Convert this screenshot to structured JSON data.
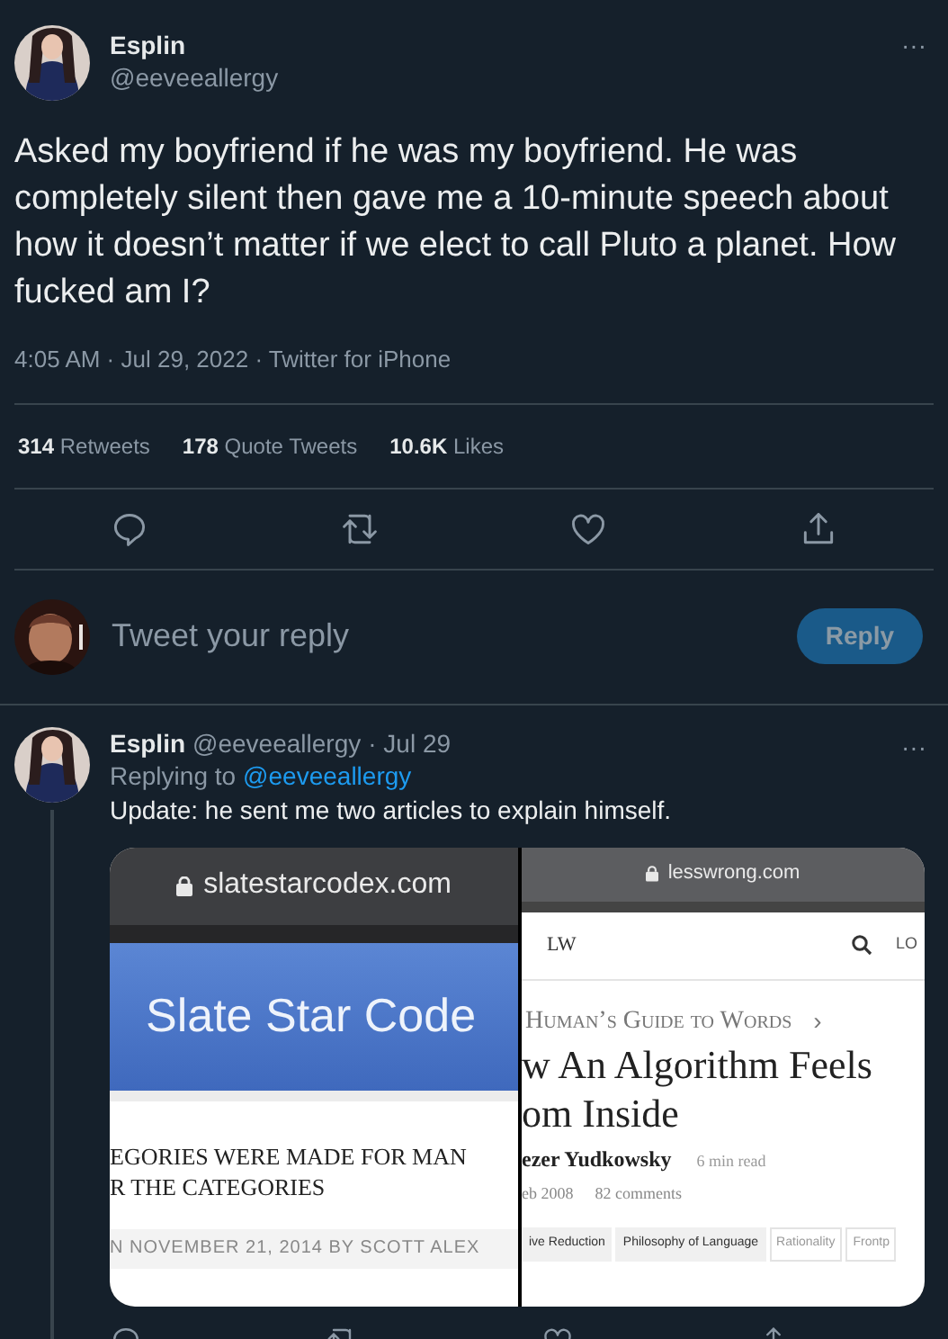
{
  "tweet": {
    "name": "Esplin",
    "handle": "@eeveeallergy",
    "text": "Asked my boyfriend if he was my boyfriend. He was completely silent then gave me a 10-minute speech about how it doesn’t matter if we elect to call Pluto a planet. How fucked am I?",
    "meta": "4:05 AM · Jul 29, 2022 · Twitter for iPhone",
    "more": "···",
    "stats": [
      {
        "count": "314",
        "label": "Retweets"
      },
      {
        "count": "178",
        "label": "Quote Tweets"
      },
      {
        "count": "10.6K",
        "label": "Likes"
      }
    ],
    "actions": [
      {
        "kind": "reply"
      },
      {
        "kind": "retweet"
      },
      {
        "kind": "like"
      },
      {
        "kind": "share"
      }
    ]
  },
  "reply_box": {
    "placeholder": "Tweet your reply",
    "button": "Reply",
    "disabled": true
  },
  "reply": {
    "name": "Esplin",
    "handle": "@eeveeallergy",
    "date": "· Jul 29",
    "more": "···",
    "replying_label": "Replying to",
    "replying_to": "@eeveeallergy",
    "text": "Update: he sent me two articles to explain himself.",
    "attachment": {
      "left": {
        "url": "slatestarcodex.com",
        "site_title": "Slate Star Code",
        "headline": [
          "EGORIES WERE MADE FOR MAN",
          "R THE CATEGORIES"
        ],
        "byline": "N NOVEMBER 21, 2014 BY SCOTT ALEX"
      },
      "right": {
        "url": "lesswrong.com",
        "logo": "LW",
        "login": "LO",
        "sequence": "Human’s Guide to Words",
        "sequence_arrow": "›",
        "title": [
          "w An Algorithm Feels",
          "om Inside"
        ],
        "author": "ezer Yudkowsky",
        "read_time": "6 min read",
        "date": "eb 2008",
        "comments": "82 comments",
        "tags": [
          "ive Reduction",
          "Philosophy of Language",
          "Rationality",
          "Frontp"
        ]
      }
    },
    "actions": [
      {
        "kind": "reply"
      },
      {
        "kind": "retweet"
      },
      {
        "kind": "like"
      },
      {
        "kind": "share"
      }
    ]
  }
}
